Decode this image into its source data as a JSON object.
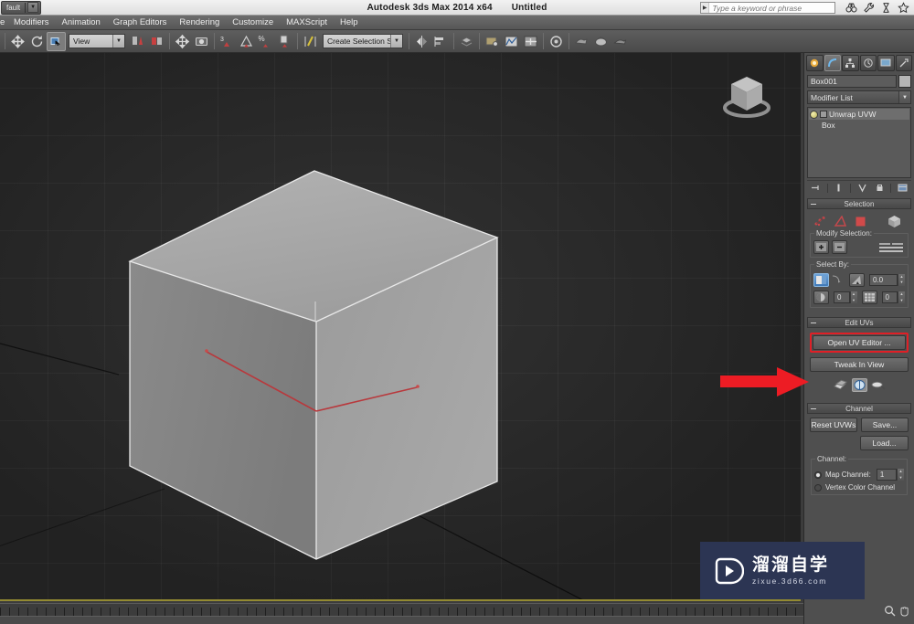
{
  "titlebar": {
    "quick_access_label": "fault",
    "app_title": "Autodesk 3ds Max  2014 x64",
    "document_title": "Untitled",
    "search_placeholder": "Type a keyword or phrase",
    "icons": [
      "binoculars-icon",
      "wrench-icon",
      "hourglass-icon",
      "star-icon"
    ]
  },
  "menubar": {
    "items": [
      {
        "label": "e"
      },
      {
        "label": "Modifiers"
      },
      {
        "label": "Animation"
      },
      {
        "label": "Graph Editors"
      },
      {
        "label": "Rendering"
      },
      {
        "label": "Customize"
      },
      {
        "label": "MAXScript"
      },
      {
        "label": "Help"
      }
    ]
  },
  "toolbar": {
    "view_combo_value": "View",
    "selection_set_value": "Create Selection Set",
    "buttons": [
      "undo-icon",
      "redo-icon",
      "select-object-icon",
      "select-by-name-icon",
      "select-region-icon",
      "move-icon",
      "rotate-icon",
      "scale-icon",
      "reference-coord-icon",
      "pivot-icon",
      "snap-toggle-icon",
      "angle-snap-icon",
      "percent-snap-icon",
      "spinner-snap-icon",
      "edit-named-selection-icon",
      "mirror-icon",
      "align-icon",
      "layer-manager-icon",
      "graph-editor-icon",
      "curve-editor-icon",
      "schematic-view-icon",
      "material-editor-icon",
      "render-setup-icon",
      "render-frame-icon",
      "render-production-icon"
    ]
  },
  "viewport": {
    "object_name": "Box001",
    "viewcube_label": "viewcube"
  },
  "command_panel": {
    "tabs": [
      {
        "name": "create-tab",
        "icon": "create-icon",
        "selected": false
      },
      {
        "name": "modify-tab",
        "icon": "modify-icon",
        "selected": true
      },
      {
        "name": "hierarchy-tab",
        "icon": "hierarchy-icon",
        "selected": false
      },
      {
        "name": "motion-tab",
        "icon": "motion-icon",
        "selected": false
      },
      {
        "name": "display-tab",
        "icon": "display-icon",
        "selected": false
      },
      {
        "name": "utilities-tab",
        "icon": "utilities-icon",
        "selected": false
      }
    ],
    "object_name": "Box001",
    "modifier_list_label": "Modifier List",
    "stack": [
      {
        "label": "Unwrap UVW",
        "selected": true
      },
      {
        "label": "Box",
        "selected": false
      }
    ],
    "rollouts": {
      "selection": {
        "title": "Selection",
        "subobject_icons": [
          "vertex-select-icon",
          "edge-select-icon",
          "face-select-icon",
          "element-select-icon"
        ],
        "modify_selection_label": "Modify Selection:",
        "modify_buttons": [
          "grow-selection-icon",
          "shrink-selection-icon"
        ],
        "loop_label": "ring-loop-lines",
        "select_by_label": "Select By:",
        "fields": [
          {
            "name": "planar-angle-field",
            "value": "0.0"
          },
          {
            "name": "element-field",
            "value": "0"
          },
          {
            "name": "material-id-field",
            "value": "0"
          }
        ]
      },
      "edit_uvs": {
        "title": "Edit UVs",
        "open_uv_editor_label": "Open UV Editor ...",
        "open_uv_editor_highlighted": true,
        "tweak_in_view_label": "Tweak In View",
        "tool_icons": [
          "peel-mode-icon",
          "pelt-map-icon",
          "relax-icon"
        ]
      },
      "channel": {
        "title": "Channel",
        "reset_uvws_label": "Reset UVWs",
        "save_label": "Save...",
        "load_label": "Load...",
        "channel_group_label": "Channel:",
        "map_channel_label": "Map Channel:",
        "map_channel_value": "1",
        "map_channel_selected": true,
        "vertex_color_label": "Vertex Color Channel",
        "vertex_color_selected": false
      }
    }
  },
  "annotation": {
    "arrow_name": "red-pointer-arrow",
    "arrow_color": "#ED1C24",
    "highlight_color": "#E01F26",
    "points_to": "Open UV Editor ..."
  },
  "watermark": {
    "brand_cn": "溜溜自学",
    "brand_url": "zixue.3d66.com",
    "background": "#2c3553"
  }
}
